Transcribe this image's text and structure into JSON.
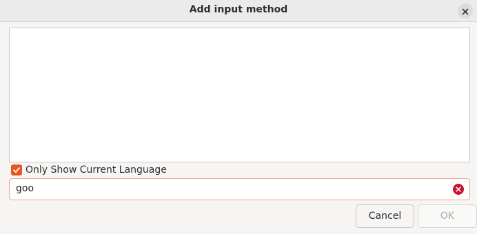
{
  "dialog": {
    "title": "Add input method",
    "close_icon": "close-icon"
  },
  "list": {
    "items": []
  },
  "filter": {
    "only_current_language_label": "Only Show Current Language",
    "only_current_language_checked": true
  },
  "search": {
    "value": "goo",
    "clear_icon": "clear-icon"
  },
  "buttons": {
    "cancel_label": "Cancel",
    "ok_label": "OK",
    "ok_enabled": false
  },
  "colors": {
    "accent": "#e95420",
    "clear": "#c7162b"
  }
}
